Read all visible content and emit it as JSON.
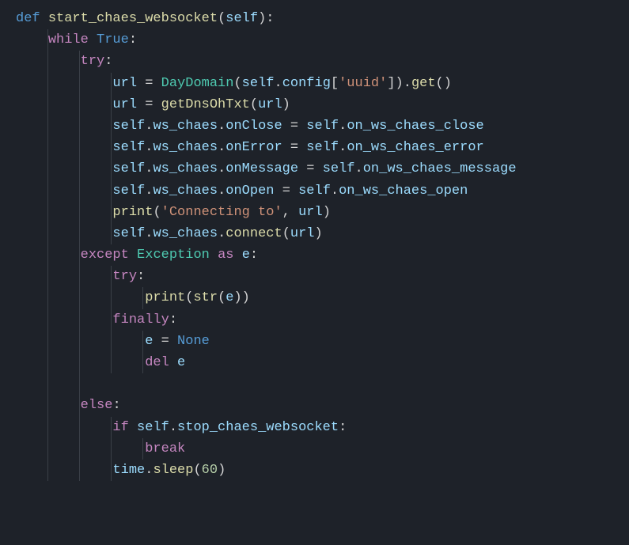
{
  "indent_guides": [
    0,
    40,
    80,
    120,
    160
  ],
  "tokens": {
    "def": "def",
    "while": "while",
    "try": "try",
    "except": "except",
    "as": "as",
    "e": "e",
    "finally": "finally",
    "else": "else",
    "if": "if",
    "break": "break",
    "del": "del",
    "True": "True",
    "None": "None",
    "self": "self",
    "print": "print",
    "str": "str",
    "fn_name": "start_chaes_websocket",
    "url": "url",
    "DayDomain": "DayDomain",
    "config": "config",
    "uuid_str": "'uuid'",
    "get": "get",
    "getDnsOhTxt": "getDnsOhTxt",
    "ws_chaes": "ws_chaes",
    "onClose": "onClose",
    "onError": "onError",
    "onMessage": "onMessage",
    "onOpen": "onOpen",
    "on_ws_chaes_close": "on_ws_chaes_close",
    "on_ws_chaes_error": "on_ws_chaes_error",
    "on_ws_chaes_message": "on_ws_chaes_message",
    "on_ws_chaes_open": "on_ws_chaes_open",
    "connect": "connect",
    "conn_str": "'Connecting to'",
    "Exception": "Exception",
    "stop_chaes_websocket": "stop_chaes_websocket",
    "time": "time",
    "sleep": "sleep",
    "sixty": "60"
  }
}
